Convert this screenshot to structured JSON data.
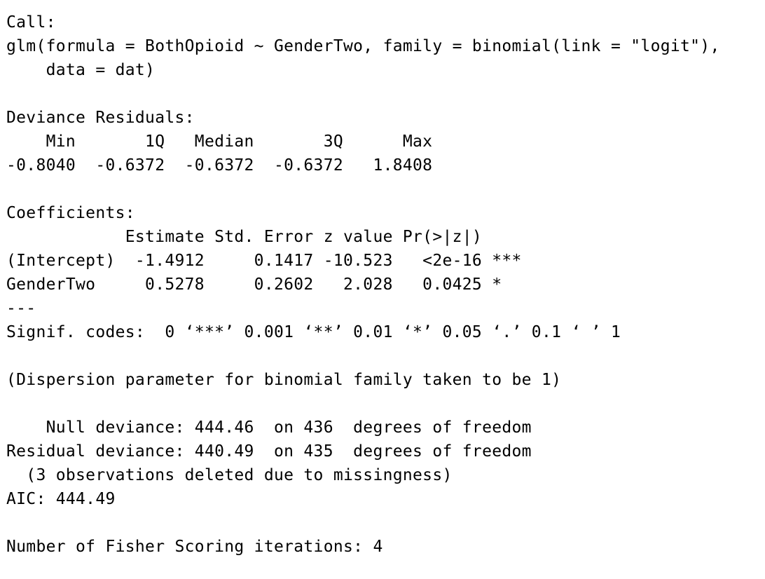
{
  "console": {
    "call_header": "Call:",
    "call_line1": "glm(formula = BothOpioid ~ GenderTwo, family = binomial(link = \"logit\"),",
    "call_line2": "    data = dat)",
    "deviance_header": "Deviance Residuals:",
    "deviance_cols": "    Min       1Q   Median       3Q      Max  ",
    "deviance_vals": "-0.8040  -0.6372  -0.6372  -0.6372   1.8408  ",
    "coef_header": "Coefficients:",
    "coef_cols": "            Estimate Std. Error z value Pr(>|z|)    ",
    "coef_row_intercept": "(Intercept)  -1.4912     0.1417 -10.523   <2e-16 ***",
    "coef_row_gender": "GenderTwo     0.5278     0.2602   2.028   0.0425 *  ",
    "sep": "---",
    "signif": "Signif. codes:  0 ‘***’ 0.001 ‘**’ 0.01 ‘*’ 0.05 ‘.’ 0.1 ‘ ’ 1",
    "dispersion": "(Dispersion parameter for binomial family taken to be 1)",
    "null_deviance": "    Null deviance: 444.46  on 436  degrees of freedom",
    "residual_deviance": "Residual deviance: 440.49  on 435  degrees of freedom",
    "missingness": "  (3 observations deleted due to missingness)",
    "aic": "AIC: 444.49",
    "fisher": "Number of Fisher Scoring iterations: 4"
  }
}
